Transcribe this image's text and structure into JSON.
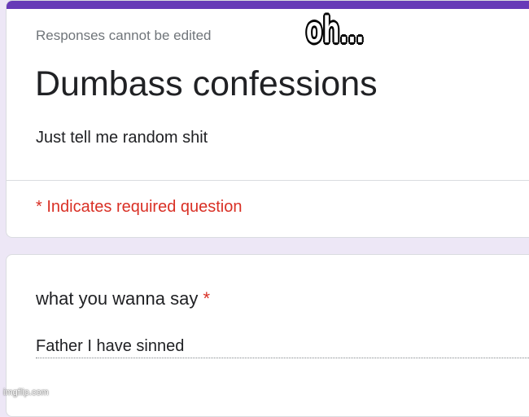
{
  "form": {
    "edit_note": "Responses cannot be edited",
    "title": "Dumbass confessions",
    "description": "Just tell me random shit",
    "required_note": "* Indicates required question",
    "accent_color": "#673ab7",
    "background_color": "#ede7f6",
    "required_color": "#d93025"
  },
  "question": {
    "title": "what you wanna say",
    "required_marker": "*",
    "answer": "Father I have sinned"
  },
  "meme": {
    "caption": "oh...",
    "watermark": "imgflip.com"
  }
}
